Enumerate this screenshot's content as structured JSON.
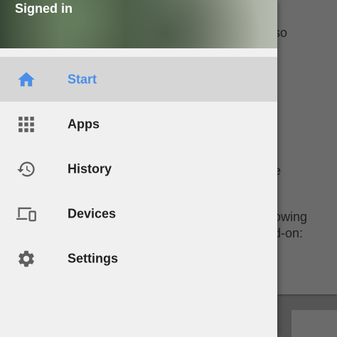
{
  "drawer": {
    "header_title": "Signed in",
    "items": [
      {
        "label": "Start",
        "icon": "home-icon",
        "active": true
      },
      {
        "label": "Apps",
        "icon": "apps-grid-icon",
        "active": false
      },
      {
        "label": "History",
        "icon": "history-icon",
        "active": false
      },
      {
        "label": "Devices",
        "icon": "devices-icon",
        "active": false
      },
      {
        "label": "Settings",
        "icon": "gear-icon",
        "active": false
      }
    ]
  },
  "background": {
    "lines": [
      "so",
      "e",
      "owing",
      "d-on:"
    ]
  },
  "colors": {
    "accent": "#4a8ee8",
    "icon_gray": "#5f5f5f",
    "drawer_bg": "#f0f0f0",
    "active_bg": "#d6d6d6"
  }
}
